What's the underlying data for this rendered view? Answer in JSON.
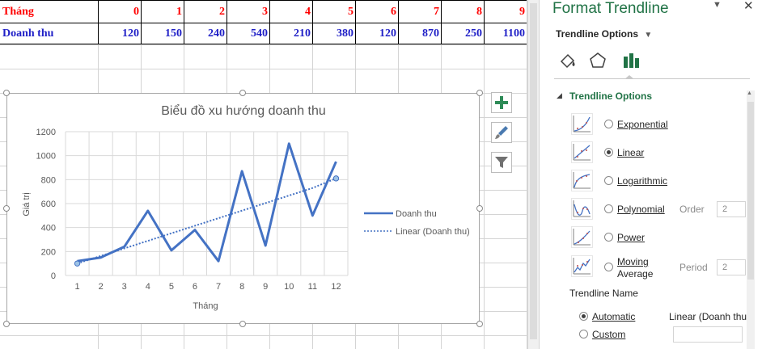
{
  "sheet": {
    "row1_label": "Tháng",
    "row2_label": "Doanh thu",
    "months": [
      "0",
      "1",
      "2",
      "3",
      "4",
      "5",
      "6",
      "7",
      "8",
      "9"
    ],
    "revenues": [
      "120",
      "150",
      "240",
      "540",
      "210",
      "380",
      "120",
      "870",
      "250",
      "1100"
    ]
  },
  "chart": {
    "title": "Biểu đồ xu hướng doanh thu",
    "xlabel": "Tháng",
    "ylabel": "Giá trị",
    "legend_series": "Doanh thu",
    "legend_trend": "Linear (Doanh thu)",
    "y_ticks": [
      "0",
      "200",
      "400",
      "600",
      "800",
      "1000",
      "1200"
    ],
    "x_ticks": [
      "1",
      "2",
      "3",
      "4",
      "5",
      "6",
      "7",
      "8",
      "9",
      "10",
      "11",
      "12"
    ]
  },
  "chart_data": {
    "type": "line",
    "title": "Biểu đồ xu hướng doanh thu",
    "xlabel": "Tháng",
    "ylabel": "Giá trị",
    "x": [
      1,
      2,
      3,
      4,
      5,
      6,
      7,
      8,
      9,
      10,
      11,
      12
    ],
    "ylim": [
      0,
      1200
    ],
    "grid": true,
    "legend": "right",
    "series": [
      {
        "name": "Doanh thu",
        "values": [
          120,
          150,
          240,
          540,
          210,
          380,
          120,
          870,
          250,
          1100,
          500,
          950
        ],
        "color": "#4472c4"
      },
      {
        "name": "Linear (Doanh thu)",
        "style": "dotted",
        "values": [
          100,
          163,
          226,
          289,
          352,
          415,
          478,
          541,
          604,
          667,
          730,
          810
        ],
        "color": "#4472c4"
      }
    ]
  },
  "side_buttons": {
    "add_icon": "plus-icon",
    "style_icon": "brush-icon",
    "filter_icon": "filter-icon"
  },
  "pane": {
    "title": "Format Trendline",
    "menu": "Trendline Options",
    "section": "Trendline Options",
    "tab_icons": [
      "fill-line-icon",
      "effects-pentagon-icon",
      "bar-chart-icon"
    ],
    "options": {
      "exponential": "Exponential",
      "linear": "Linear",
      "logarithmic": "Logarithmic",
      "polynomial": "Polynomial",
      "power": "Power",
      "moving_average_1": "Moving",
      "moving_average_2": "Average"
    },
    "order_label": "Order",
    "order_value": "2",
    "period_label": "Period",
    "period_value": "2",
    "name_heading": "Trendline Name",
    "automatic": "Automatic",
    "automatic_value": "Linear (Doanh thu",
    "custom": "Custom",
    "selected_type": "Linear",
    "selected_name": "Automatic"
  },
  "colors": {
    "accent": "#217346",
    "series": "#4472c4",
    "row1_text": "#ff0000",
    "row2_text": "#1f1fc7"
  }
}
